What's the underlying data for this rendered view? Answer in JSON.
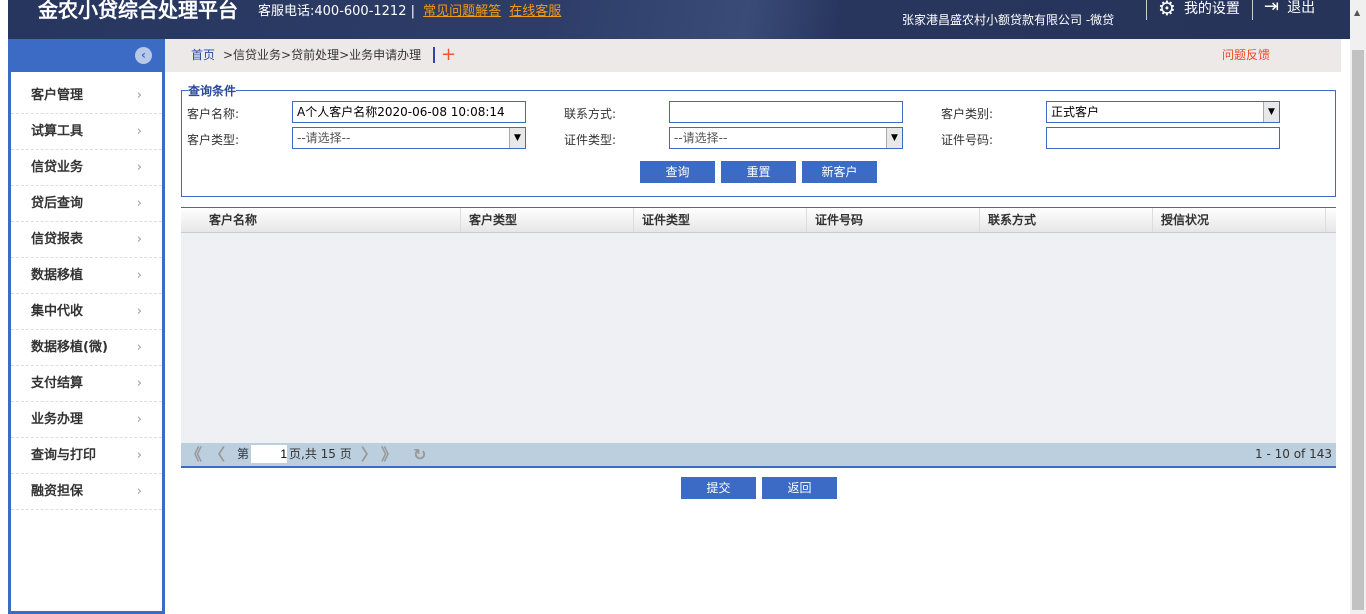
{
  "header": {
    "title": "金农小贷综合处理平台",
    "phone": "客服电话:400-600-1212",
    "faq": "常见问题解答",
    "online": "在线客服",
    "org": "张家港昌盛农村小额贷款有限公司 -微贷",
    "settings": "我的设置",
    "logout": "退出"
  },
  "sidebar": {
    "items": [
      {
        "label": "客户管理"
      },
      {
        "label": "试算工具"
      },
      {
        "label": "信贷业务"
      },
      {
        "label": "贷后查询"
      },
      {
        "label": "信贷报表"
      },
      {
        "label": "数据移植"
      },
      {
        "label": "集中代收"
      },
      {
        "label": "数据移植(微)"
      },
      {
        "label": "支付结算"
      },
      {
        "label": "业务办理"
      },
      {
        "label": "查询与打印"
      },
      {
        "label": "融资担保"
      }
    ]
  },
  "breadcrumb": {
    "home": "首页",
    "path": ">信贷业务>贷前处理>业务申请办理",
    "feedback": "问题反馈"
  },
  "query": {
    "legend": "查询条件",
    "name_label": "客户名称:",
    "name_value": "A个人客户名称2020-06-08 10:08:14",
    "contact_label": "联系方式:",
    "contact_value": "",
    "category_label": "客户类别:",
    "category_value": "正式客户",
    "type_label": "客户类型:",
    "type_value": "--请选择--",
    "idtype_label": "证件类型:",
    "idtype_value": "--请选择--",
    "idno_label": "证件号码:",
    "idno_value": "",
    "search": "查询",
    "reset": "重置",
    "new": "新客户"
  },
  "grid": {
    "columns": [
      "客户名称",
      "客户类型",
      "证件类型",
      "证件号码",
      "联系方式",
      "授信状况"
    ],
    "pager": {
      "page_prefix": "第",
      "page": "1",
      "page_suffix": "页,共 15 页",
      "summary": "1 - 10 of 143"
    }
  },
  "actions": {
    "submit": "提交",
    "back": "返回"
  }
}
